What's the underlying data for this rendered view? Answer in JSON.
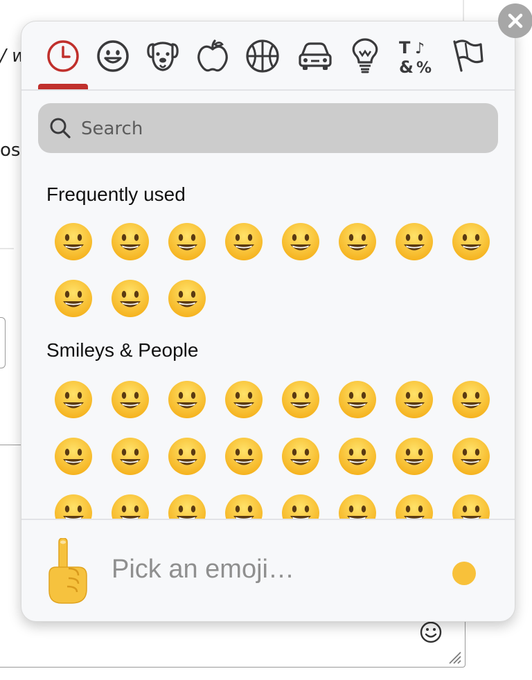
{
  "background": {
    "text_fragment_1": "/ w",
    "text_fragment_2": "osa"
  },
  "picker": {
    "nav": [
      {
        "name": "Frequently used",
        "icon": "clock-icon"
      },
      {
        "name": "Smileys & People",
        "icon": "smiley-icon"
      },
      {
        "name": "Animals & Nature",
        "icon": "dog-icon"
      },
      {
        "name": "Food & Drink",
        "icon": "apple-icon"
      },
      {
        "name": "Activities",
        "icon": "basketball-icon"
      },
      {
        "name": "Travel & Places",
        "icon": "car-icon"
      },
      {
        "name": "Objects",
        "icon": "lightbulb-icon"
      },
      {
        "name": "Symbols",
        "icon": "symbols-icon"
      },
      {
        "name": "Flags",
        "icon": "flag-icon"
      }
    ],
    "active_color": "#c0302c",
    "search": {
      "placeholder": "Search",
      "value": ""
    },
    "categories": [
      {
        "title": "Frequently used",
        "emojis": [
          {
            "name": "thumbs-up",
            "char": "👍"
          },
          {
            "name": "grinning-face",
            "char": "😀"
          },
          {
            "name": "face-blowing-kiss",
            "char": "😘"
          },
          {
            "name": "heart-eyes",
            "char": "😍"
          },
          {
            "name": "squinting-face",
            "char": "😆"
          },
          {
            "name": "winking-tongue",
            "char": "😜"
          },
          {
            "name": "grinning-sweat",
            "char": "😅"
          },
          {
            "name": "smiling-eyes",
            "char": "😊"
          },
          {
            "name": "beaming-face",
            "char": "😁"
          },
          {
            "name": "tears-of-joy",
            "char": "😂"
          },
          {
            "name": "star-struck",
            "char": "🤩"
          }
        ]
      },
      {
        "title": "Smileys & People",
        "emojis": [
          {
            "name": "grinning-face",
            "char": "😀"
          },
          {
            "name": "grinning-big-eyes",
            "char": "😃"
          },
          {
            "name": "grinning-smiling-eyes",
            "char": "😄"
          },
          {
            "name": "beaming-face",
            "char": "😁"
          },
          {
            "name": "squinting-face",
            "char": "😆"
          },
          {
            "name": "grinning-sweat",
            "char": "😅"
          },
          {
            "name": "rolling-laughing",
            "char": "🤣"
          },
          {
            "name": "tears-of-joy",
            "char": "😂"
          },
          {
            "name": "slightly-smiling",
            "char": "🙂"
          },
          {
            "name": "upside-down",
            "char": "🙃"
          },
          {
            "name": "melting-face",
            "char": "🫠"
          },
          {
            "name": "winking-face",
            "char": "😉"
          },
          {
            "name": "smiling-eyes",
            "char": "😊"
          },
          {
            "name": "halo-face",
            "char": "😇"
          },
          {
            "name": "hearts-face",
            "char": "🥰"
          },
          {
            "name": "heart-eyes",
            "char": "😍"
          },
          {
            "name": "star-struck",
            "char": "🤩"
          },
          {
            "name": "face-blowing-kiss",
            "char": "😘"
          },
          {
            "name": "kissing-face",
            "char": "😗"
          },
          {
            "name": "smiling-face",
            "char": "☺️"
          },
          {
            "name": "kissing-closed-eyes",
            "char": "😚"
          },
          {
            "name": "kissing-smiling-eyes",
            "char": "😙"
          },
          {
            "name": "smiling-tear",
            "char": "🥲"
          },
          {
            "name": "savoring-food",
            "char": "😋"
          }
        ]
      }
    ],
    "preview": {
      "label": "Pick an emoji…",
      "emoji": "☝️",
      "skin_tone_color": "#f8c13a"
    }
  }
}
